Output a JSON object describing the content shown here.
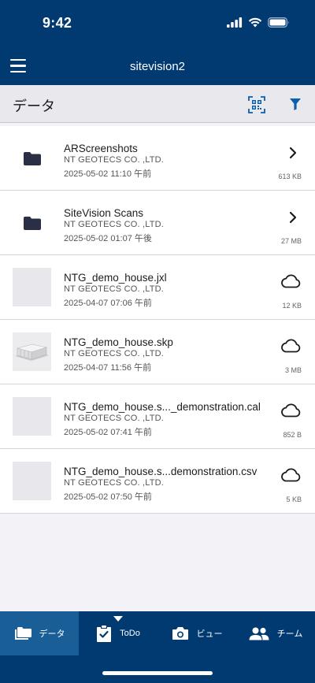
{
  "status_bar": {
    "time": "9:42"
  },
  "nav": {
    "title": "sitevision2"
  },
  "section": {
    "title": "データ"
  },
  "files": [
    {
      "kind": "folder",
      "name": "ARScreenshots",
      "company": "NT GEOTECS CO. ,LTD.",
      "date": "2025-05-02 11:10 午前",
      "size": "613 KB",
      "action": "chevron"
    },
    {
      "kind": "folder",
      "name": "SiteVision Scans",
      "company": "NT GEOTECS CO. ,LTD.",
      "date": "2025-05-02 01:07 午後",
      "size": "27 MB",
      "action": "chevron"
    },
    {
      "kind": "file",
      "name": "NTG_demo_house.jxl",
      "company": "NT GEOTECS CO. ,LTD.",
      "date": "2025-04-07 07:06 午前",
      "size": "12 KB",
      "action": "cloud"
    },
    {
      "kind": "model",
      "name": "NTG_demo_house.skp",
      "company": "NT GEOTECS CO. ,LTD.",
      "date": "2025-04-07 11:56 午前",
      "size": "3 MB",
      "action": "cloud"
    },
    {
      "kind": "file",
      "name": "NTG_demo_house.s..._demonstration.cal",
      "company": "NT GEOTECS CO. ,LTD.",
      "date": "2025-05-02 07:41 午前",
      "size": "852 B",
      "action": "cloud"
    },
    {
      "kind": "file",
      "name": "NTG_demo_house.s...demonstration.csv",
      "company": "NT GEOTECS CO. ,LTD.",
      "date": "2025-05-02 07:50 午前",
      "size": "5 KB",
      "action": "cloud"
    }
  ],
  "tabs": [
    {
      "label": "データ",
      "icon": "folder-icon",
      "active": true
    },
    {
      "label": "ToDo",
      "icon": "clipboard-check-icon",
      "active": false
    },
    {
      "label": "ビュー",
      "icon": "camera-icon",
      "active": false
    },
    {
      "label": "チーム",
      "icon": "people-icon",
      "active": false
    }
  ],
  "colors": {
    "primary": "#003a70",
    "active_tab": "#1a5e97",
    "folder": "#2b2f45",
    "header_icon": "#0a5fb0"
  }
}
